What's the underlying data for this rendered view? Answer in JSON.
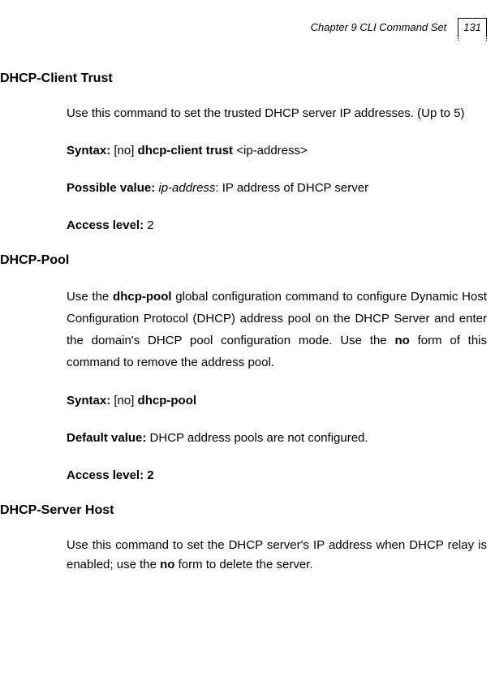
{
  "header": {
    "chapter_title": "Chapter 9 CLI Command Set",
    "page_number": "131"
  },
  "sections": [
    {
      "heading": "DHCP-Client Trust",
      "description_parts": [
        "Use this command to set the trusted DHCP server IP addresses. (Up to 5)"
      ],
      "syntax_label": "Syntax:",
      "syntax_prefix": " [no] ",
      "syntax_command": "dhcp-client trust",
      "syntax_suffix": " <ip-address>",
      "possible_value_label": "Possible value:",
      "possible_value_italic": " ip-address",
      "possible_value_text": ": IP address of DHCP server",
      "access_level_label": "Access level:",
      "access_level_value": " 2"
    },
    {
      "heading": "DHCP-Pool",
      "description_pre": "Use the ",
      "description_bold1": "dhcp-pool",
      "description_mid": " global configuration command to configure Dynamic Host Configuration Protocol (DHCP) address pool on the DHCP Server and enter the domain's DHCP pool configuration mode. Use the ",
      "description_bold2": "no",
      "description_post": " form of this command to remove the address pool.",
      "syntax_label": "Syntax:",
      "syntax_prefix": "  [no] ",
      "syntax_command": "dhcp-pool",
      "default_value_label": "Default value:",
      "default_value_text": " DHCP address pools are not configured.",
      "access_level_label": "Access level: 2"
    },
    {
      "heading": "DHCP-Server Host",
      "description_pre": "Use this command to set the DHCP server's IP address when DHCP relay is enabled; use the ",
      "description_bold": "no",
      "description_post": " form to delete the server."
    }
  ]
}
